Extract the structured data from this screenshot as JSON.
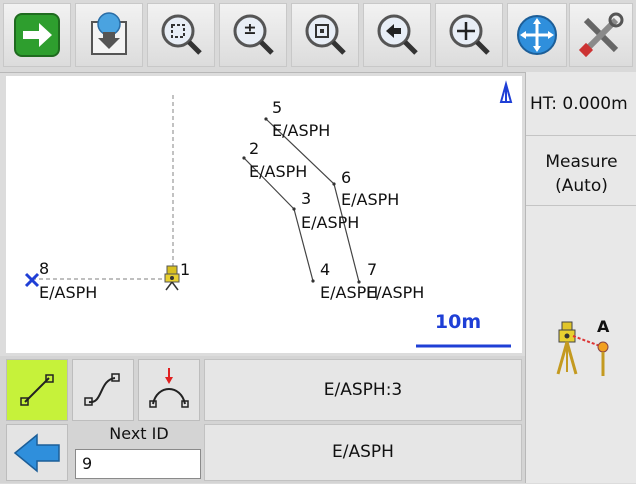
{
  "toolbar": {
    "items": [
      {
        "name": "next-arrow-button",
        "icon": "green-right-arrow-icon"
      },
      {
        "name": "download-button",
        "icon": "globe-download-icon"
      },
      {
        "name": "zoom-extents-button",
        "icon": "zoom-extents-icon"
      },
      {
        "name": "zoom-in-out-button",
        "icon": "zoom-plus-minus-icon"
      },
      {
        "name": "zoom-window-button",
        "icon": "zoom-window-icon"
      },
      {
        "name": "zoom-previous-button",
        "icon": "zoom-back-icon"
      },
      {
        "name": "zoom-pan-button",
        "icon": "zoom-pan-icon"
      },
      {
        "name": "pan-button",
        "icon": "pan-arrows-icon"
      },
      {
        "name": "settings-button",
        "icon": "tools-icon"
      }
    ]
  },
  "map": {
    "north_label": "",
    "scale_label": "10m",
    "points": [
      {
        "id": "5",
        "code": "E/ASPH"
      },
      {
        "id": "2",
        "code": "E/ASPH"
      },
      {
        "id": "6",
        "code": "E/ASPH"
      },
      {
        "id": "3",
        "code": "E/ASPH"
      },
      {
        "id": "4",
        "code": "E/ASPH"
      },
      {
        "id": "7",
        "code": "E/ASPH"
      },
      {
        "id": "8",
        "code": "E/ASPH"
      },
      {
        "id": "1",
        "code": ""
      }
    ]
  },
  "side": {
    "ht_label": "HT: 0.000m",
    "measure_line1": "Measure",
    "measure_line2": "(Auto)",
    "instrument_label": "A"
  },
  "bottom": {
    "current_code": "E/ASPH:3",
    "next_id_label": "Next ID",
    "next_id_value": "9",
    "code_label": "E/ASPH"
  },
  "colors": {
    "active_green": "#c6f23a",
    "map_blue": "#1f3fd6",
    "back_blue": "#2f8fdc"
  }
}
